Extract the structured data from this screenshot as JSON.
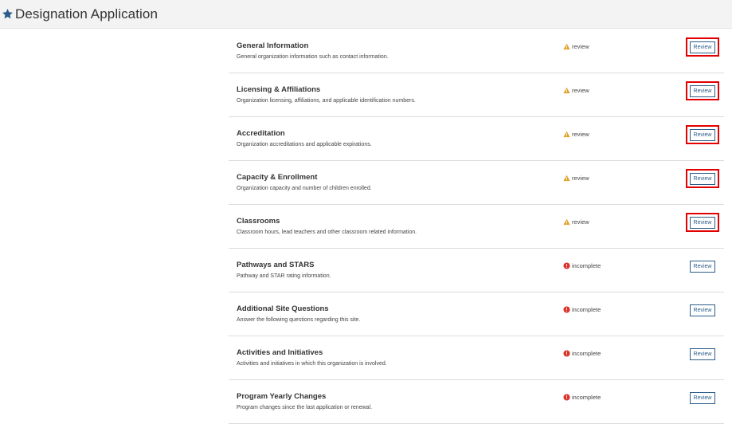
{
  "header": {
    "title": "Designation Application",
    "icon": "star-icon",
    "icon_color": "#2c5d8a"
  },
  "colors": {
    "warning": "#e0a12a",
    "error": "#d9332b",
    "button_border": "#2c5d8a",
    "highlight": "#e30000"
  },
  "sections": [
    {
      "name": "General Information",
      "description": "General organization information such as contact information.",
      "status": "review",
      "status_icon": "warning-icon",
      "button": "Review",
      "highlighted": true
    },
    {
      "name": "Licensing & Affiliations",
      "description": "Organization licensing, affiliations, and applicable identification numbers.",
      "status": "review",
      "status_icon": "warning-icon",
      "button": "Review",
      "highlighted": true
    },
    {
      "name": "Accreditation",
      "description": "Organization accreditations and applicable expirations.",
      "status": "review",
      "status_icon": "warning-icon",
      "button": "Review",
      "highlighted": true
    },
    {
      "name": "Capacity & Enrollment",
      "description": "Organization capacity and number of children enrolled.",
      "status": "review",
      "status_icon": "warning-icon",
      "button": "Review",
      "highlighted": true
    },
    {
      "name": "Classrooms",
      "description": "Classroom hours, lead teachers and other classroom related information.",
      "status": "review",
      "status_icon": "warning-icon",
      "button": "Review",
      "highlighted": true
    },
    {
      "name": "Pathways and STARS",
      "description": "Pathway and STAR rating information.",
      "status": "incomplete",
      "status_icon": "error-icon",
      "button": "Review",
      "highlighted": false
    },
    {
      "name": "Additional Site Questions",
      "description": "Answer the following questions regarding this site.",
      "status": "incomplete",
      "status_icon": "error-icon",
      "button": "Review",
      "highlighted": false
    },
    {
      "name": "Activities and Initiatives",
      "description": "Activities and initiatives in which this organization is involved.",
      "status": "incomplete",
      "status_icon": "error-icon",
      "button": "Review",
      "highlighted": false
    },
    {
      "name": "Program Yearly Changes",
      "description": "Program changes since the last application or renewal.",
      "status": "incomplete",
      "status_icon": "error-icon",
      "button": "Review",
      "highlighted": false
    }
  ]
}
